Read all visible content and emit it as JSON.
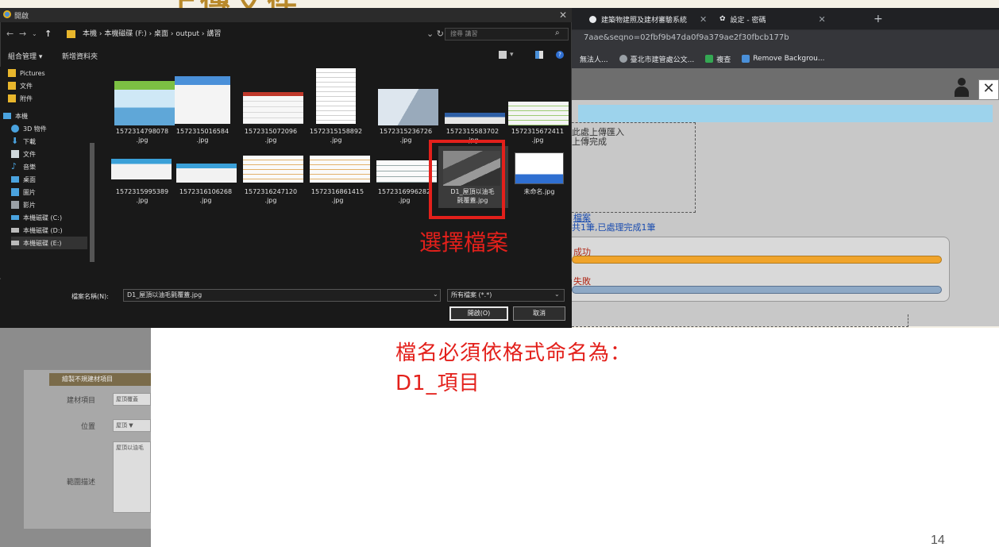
{
  "slide": {
    "title": "上傳文件",
    "page_number": "14",
    "note_line1": "檔名必須依格式命名為：",
    "note_line2": "D1_項目"
  },
  "browser": {
    "tabs": [
      {
        "label": "建築物建照及建材審驗系統"
      },
      {
        "label": "設定 - 密碼"
      }
    ],
    "address_fragment": "7aae&seqno=02fbf9b47da0f9a379ae2f30fbcb177b",
    "bookmarks": [
      {
        "label": "無法人...",
        "color": "#d9a62b"
      },
      {
        "label": "臺北市建管處公文...",
        "color": "#9aa0a6"
      },
      {
        "label": "複查",
        "color": "#34a853"
      },
      {
        "label": "Remove Backgrou...",
        "color": "#4a90d9"
      }
    ]
  },
  "upload_page": {
    "drop_text1": "此處上傳匯入",
    "drop_text2": "上傳完成",
    "link_text": "檔案",
    "count_text": "共1筆,已處理完成1筆",
    "success_label": "成功",
    "fail_label": "失敗",
    "success_progress": 1.0,
    "fail_progress": 1.0
  },
  "background_form": {
    "header": "繪製不規建材項目",
    "fields": [
      {
        "label": "建材項目",
        "value": "屋頂覆蓋"
      },
      {
        "label": "位置",
        "value": "屋頂 ▼"
      },
      {
        "label": "範圍描述",
        "value": "屋頂以油毛"
      }
    ]
  },
  "dialog": {
    "title": "開啟",
    "close": "✕",
    "path_segments": "本機  ›  本機磁碟 (F:)  ›  桌面  ›  output  ›  講習",
    "search_placeholder": "搜尋 講習",
    "toolbar": {
      "organize": "組合管理 ▾",
      "new_folder": "新增資料夾"
    },
    "nav_items": [
      {
        "label": "Pictures",
        "icon": "folder-icon",
        "color": "#e8b62c"
      },
      {
        "label": "文件",
        "icon": "folder-icon",
        "color": "#e8b62c"
      },
      {
        "label": "附件",
        "icon": "folder-icon",
        "color": "#e8b62c"
      },
      {
        "label": "本機",
        "icon": "computer-icon",
        "color": "#4aa3df"
      },
      {
        "label": "3D 物件",
        "icon": "3d-objects-icon",
        "color": "#4aa3df"
      },
      {
        "label": "下載",
        "icon": "download-icon",
        "color": "#4aa3df"
      },
      {
        "label": "文件",
        "icon": "documents-icon",
        "color": "#cfd8dc"
      },
      {
        "label": "音樂",
        "icon": "music-icon",
        "color": "#4aa3df"
      },
      {
        "label": "桌面",
        "icon": "desktop-icon",
        "color": "#4aa3df"
      },
      {
        "label": "圖片",
        "icon": "pictures-icon",
        "color": "#4aa3df"
      },
      {
        "label": "影片",
        "icon": "videos-icon",
        "color": "#9aa0a6"
      },
      {
        "label": "本機磁碟 (C:)",
        "icon": "drive-icon",
        "color": "#4aa3df"
      },
      {
        "label": "本機磁碟 (D:)",
        "icon": "drive-icon",
        "color": "#bbbbbb"
      },
      {
        "label": "本機磁碟 (E:)",
        "icon": "drive-icon",
        "color": "#bbbbbb"
      }
    ],
    "files_row1": [
      {
        "name": "1572314798078",
        "ext": ".jpg"
      },
      {
        "name": "1572315016584",
        "ext": ".jpg"
      },
      {
        "name": "1572315072096",
        "ext": ".jpg"
      },
      {
        "name": "1572315158892",
        "ext": ".jpg"
      },
      {
        "name": "1572315236726",
        "ext": ".jpg"
      },
      {
        "name": "1572315583702",
        "ext": ".jpg"
      },
      {
        "name": "1572315672411",
        "ext": ".jpg"
      }
    ],
    "files_row2": [
      {
        "name": "1572315995389",
        "ext": ".jpg"
      },
      {
        "name": "1572316106268",
        "ext": ".jpg"
      },
      {
        "name": "1572316247120",
        "ext": ".jpg"
      },
      {
        "name": "1572316861415",
        "ext": ".jpg"
      },
      {
        "name": "1572316996282",
        "ext": ".jpg"
      },
      {
        "name": "D1_屋頂以油毛",
        "ext": "氈覆蓋.jpg"
      },
      {
        "name": "未命名.jpg",
        "ext": ""
      }
    ],
    "select_annotation": "選擇檔案",
    "filename_label": "檔案名稱(N):",
    "filename_value": "D1_屋頂以油毛氈覆蓋.jpg",
    "filetype_value": "所有檔案 (*.*)",
    "open_button": "開啟(O)",
    "cancel_button": "取消"
  }
}
